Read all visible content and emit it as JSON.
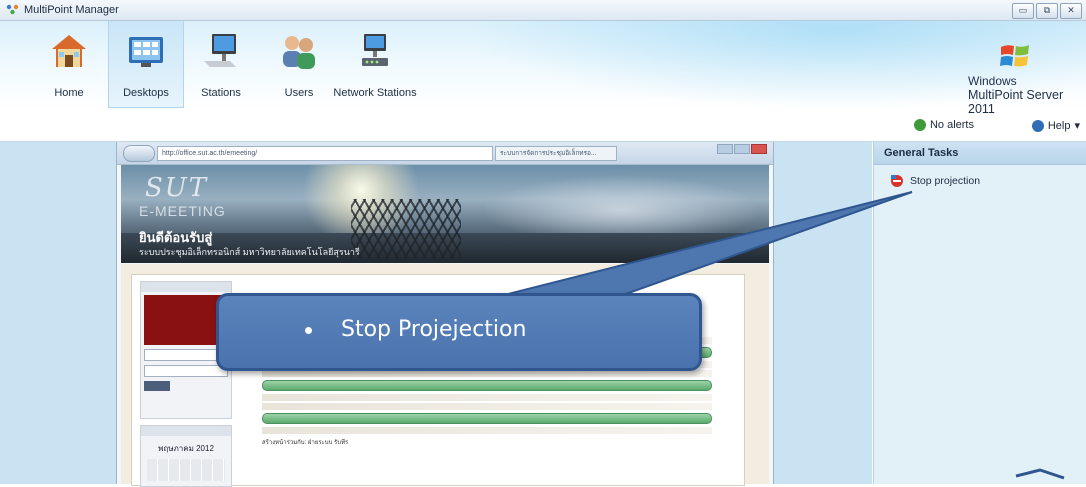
{
  "window": {
    "title": "MultiPoint Manager",
    "controls": [
      "minimize",
      "restore",
      "close"
    ]
  },
  "ribbon": {
    "buttons": [
      {
        "label": "Home",
        "icon": "house-icon",
        "active": false
      },
      {
        "label": "Desktops",
        "icon": "desktops-icon",
        "active": true
      },
      {
        "label": "Stations",
        "icon": "stations-icon",
        "active": false
      },
      {
        "label": "Users",
        "icon": "users-icon",
        "active": false
      },
      {
        "label": "Network Stations",
        "icon": "network-stations-icon",
        "active": false
      }
    ],
    "brand_line1": "Windows",
    "brand_line2": "MultiPoint Server 2011"
  },
  "status": {
    "alerts_label": "No alerts",
    "help_label": "Help"
  },
  "preview": {
    "address": "http://office.sut.ac.th/emeeting/",
    "tab_title": "ระบบการจัดการประชุมอิเล็กทรอ...",
    "banner_title": "SUT",
    "banner_subtitle": "E-MEETING",
    "welcome_text": "ยินดีต้อนรับสู่",
    "welcome_sub": "ระบบประชุมอิเล็กทรอนิกส์ มหาวิทยาลัยเทคโนโลยีสุรนารี",
    "calendar_title": "พฤษภาคม 2012",
    "footnote": "สร้างหน้าร่วมกับ: ฝ่ายระบบ รับทีร"
  },
  "tasks": {
    "header": "General Tasks",
    "items": [
      {
        "label": "Stop projection",
        "icon": "stop-projection-icon"
      }
    ]
  },
  "callout": {
    "text": "Stop  Projejection"
  },
  "colors": {
    "ribbon_top": "#daf0fb",
    "content_bg": "#c9e3f3",
    "callout_fill": "#4f79b3",
    "callout_border": "#2f568f"
  }
}
